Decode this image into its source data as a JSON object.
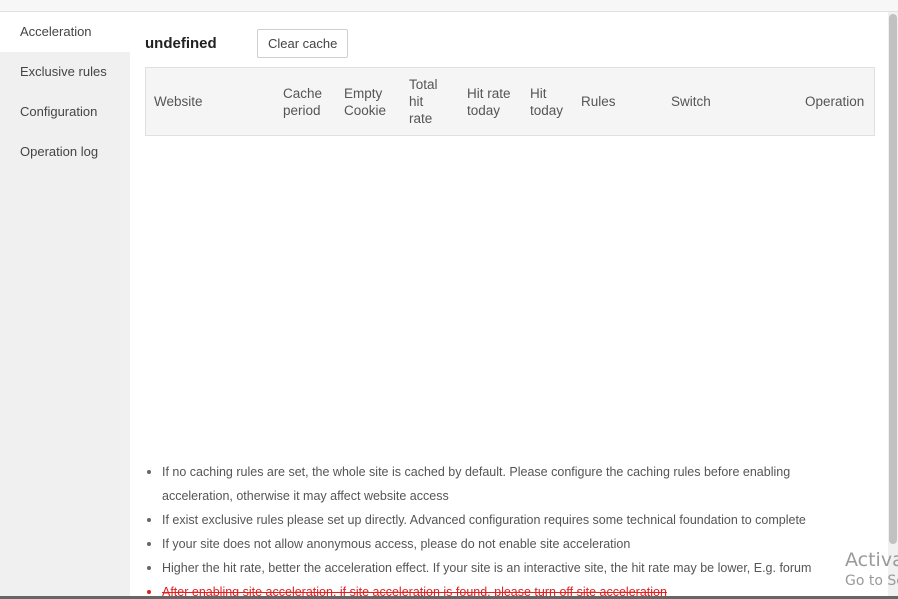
{
  "sidebar": {
    "items": [
      {
        "label": "Acceleration"
      },
      {
        "label": "Exclusive rules"
      },
      {
        "label": "Configuration"
      },
      {
        "label": "Operation log"
      }
    ]
  },
  "header": {
    "site_title": "undefined",
    "clear_cache_label": "Clear cache"
  },
  "table": {
    "columns": [
      "Website",
      "Cache period",
      "Empty Cookie",
      "Total hit rate",
      "Hit rate today",
      "Hit today",
      "Rules",
      "Switch",
      "Operation"
    ],
    "rows": []
  },
  "tips": [
    "If no caching rules are set, the whole site is cached by default. Please configure the caching rules before enabling acceleration, otherwise it may affect website access",
    "If exist exclusive rules please set up directly. Advanced configuration requires some technical foundation to complete",
    "If your site does not allow anonymous access, please do not enable site acceleration",
    "Higher the hit rate, better the acceleration effect. If your site is an interactive site, the hit rate may be lower, E.g. forum",
    "After enabling site acceleration, if site acceleration is found, please turn off site acceleration"
  ],
  "watermark": {
    "line1": "Activa",
    "line2": "Go to Se"
  }
}
